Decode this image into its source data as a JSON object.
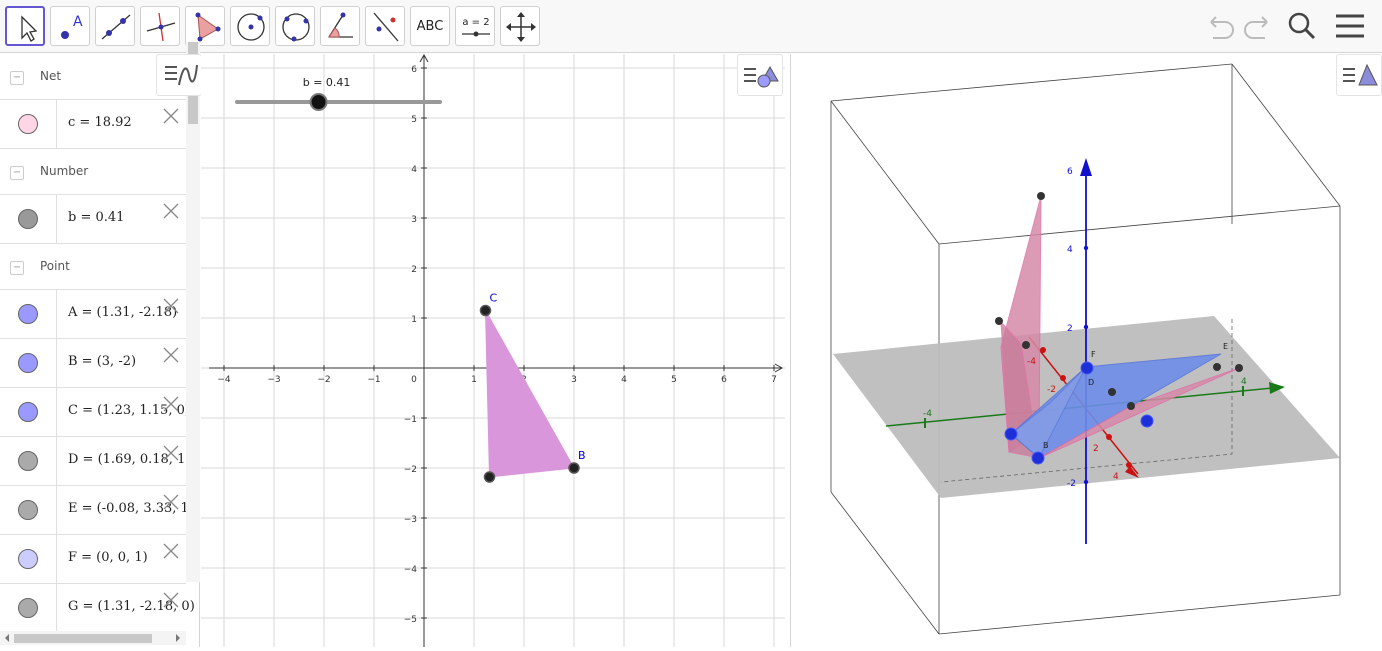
{
  "toolbar": {
    "tools": [
      {
        "icon": "move-icon",
        "selected": true
      },
      {
        "icon": "point-icon",
        "selected": false
      },
      {
        "icon": "line-icon",
        "selected": false
      },
      {
        "icon": "perpendicular-line-icon",
        "selected": false
      },
      {
        "icon": "polygon-icon",
        "selected": false
      },
      {
        "icon": "circle-center-point-icon",
        "selected": false
      },
      {
        "icon": "circle-three-points-icon",
        "selected": false
      },
      {
        "icon": "angle-icon",
        "selected": false
      },
      {
        "icon": "reflect-about-line-icon",
        "selected": false
      },
      {
        "icon": "text-icon",
        "label": "ABC",
        "selected": false
      },
      {
        "icon": "slider-icon",
        "label": "a = 2",
        "selected": false
      },
      {
        "icon": "move-graphics-view-icon",
        "selected": false
      }
    ],
    "right": [
      "undo-icon",
      "redo-icon",
      "search-icon",
      "menu-icon"
    ]
  },
  "algebra": {
    "rows": [
      {
        "type": "group",
        "name": "Net"
      },
      {
        "type": "item",
        "value": "c = 18.92",
        "color": "#ffd6e6"
      },
      {
        "type": "group",
        "name": "Number"
      },
      {
        "type": "item",
        "value": "b = 0.41",
        "color": "#999999"
      },
      {
        "type": "group",
        "name": "Point"
      },
      {
        "type": "item",
        "value": "A = (1.31, -2.18)",
        "color": "#9999ff"
      },
      {
        "type": "item",
        "value": "B = (3, -2)",
        "color": "#9999ff"
      },
      {
        "type": "item",
        "value": "C = (1.23, 1.15, 0)",
        "color": "#9999ff"
      },
      {
        "type": "item",
        "value": "D = (1.69, 0.18, 1)",
        "color": "#aaaaaa"
      },
      {
        "type": "item",
        "value": "E = (-0.08, 3.33, 1)",
        "color": "#aaaaaa"
      },
      {
        "type": "item",
        "value": "F = (0, 0, 1)",
        "color": "#ccccff"
      },
      {
        "type": "item",
        "value": "G = (1.31, -2.18, 0)",
        "color": "#aaaaaa"
      }
    ]
  },
  "graphics": {
    "slider": {
      "label": "b = 0.41",
      "value": 0.41
    },
    "x_ticks": [
      "−4",
      "−3",
      "−2",
      "−1",
      "0",
      "1",
      "2",
      "3",
      "4",
      "5",
      "6",
      "7"
    ],
    "y_ticks": [
      "6",
      "5",
      "4",
      "3",
      "2",
      "1",
      "−1",
      "−2",
      "−3",
      "−4",
      "−5"
    ],
    "points": [
      {
        "name": "C",
        "label": "C",
        "x": 1.23,
        "y": 1.15
      },
      {
        "name": "B",
        "label": "B",
        "x": 3,
        "y": -2
      },
      {
        "name": "A",
        "label": "",
        "x": 1.31,
        "y": -2.18
      }
    ],
    "polygon_color": "#da96da"
  },
  "view3d": {
    "z_ticks": [
      "6",
      "4",
      "2",
      "-2"
    ],
    "x_ticks": [
      "-4",
      "-2",
      "2",
      "4"
    ],
    "y_ticks": [
      "-4",
      "4"
    ],
    "point_labels": [
      "D",
      "E",
      "F",
      "B"
    ]
  }
}
